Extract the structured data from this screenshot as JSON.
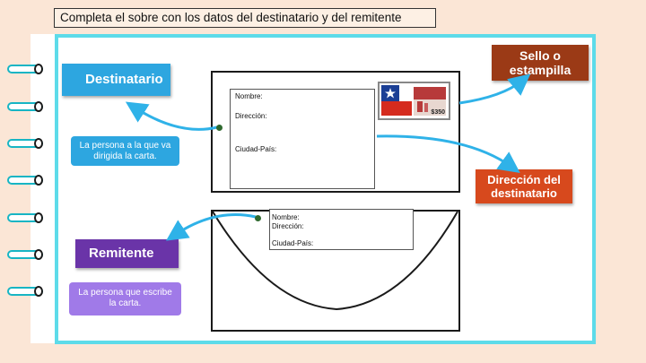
{
  "instruction": "Completa el sobre con los datos del destinatario y del remitente",
  "labels": {
    "destinatario": "Destinatario",
    "remitente": "Remitente",
    "sello_line1": "Sello o",
    "sello_line2": "estampilla",
    "direccion_line1": "Dirección del",
    "direccion_line2": "destinatario"
  },
  "descriptions": {
    "destinatario_line1": "La persona a la que va",
    "destinatario_line2": "dirigida la carta.",
    "remitente_line1": "La persona que escribe",
    "remitente_line2": "la carta."
  },
  "envelope_front": {
    "nombre": "Nombre:",
    "direccion": "Dirección:",
    "ciudad_pais": "Ciudad-País:",
    "stamp_value": "$350"
  },
  "envelope_back": {
    "nombre": "Nombre:",
    "direccion": "Dirección:",
    "ciudad_pais": "Ciudad-País:"
  },
  "colors": {
    "frame": "#5ddbe9",
    "destinatario": "#2da6e0",
    "remitente": "#6a34a8",
    "remitente_desc": "#a07ae8",
    "sello": "#9b3a16",
    "direccion": "#d7491d"
  }
}
